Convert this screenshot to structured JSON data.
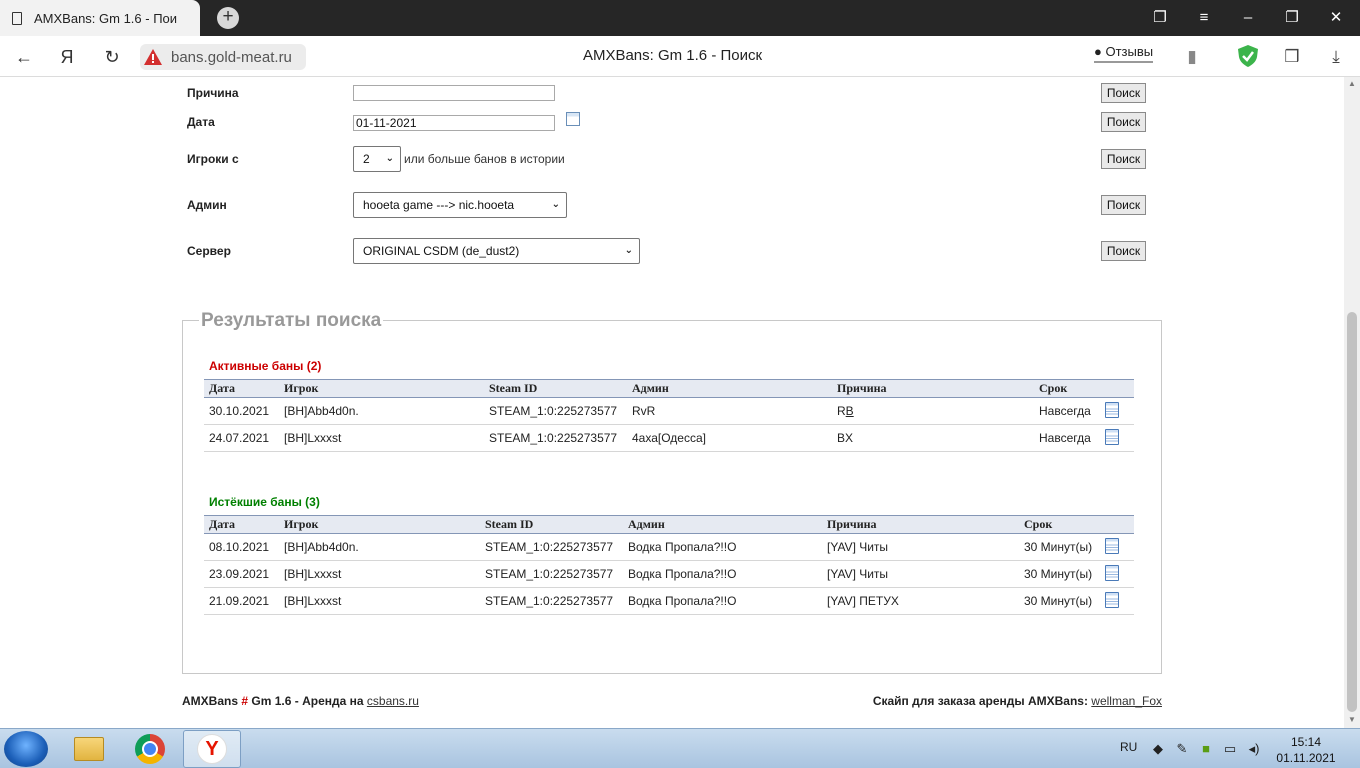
{
  "browser": {
    "tab_title": "AMXBans: Gm 1.6 - Пои",
    "url": "bans.gold-meat.ru",
    "page_title": "AMXBans: Gm 1.6 - Поиск",
    "reviews_label": "Отзывы"
  },
  "form": {
    "reason_label": "Причина",
    "reason_value": "",
    "date_label": "Дата",
    "date_value": "01-11-2021",
    "players_label": "Игроки с",
    "players_count": "2",
    "players_hint": "или больше банов в истории",
    "admin_label": "Админ",
    "admin_selected": "hooeta game ---> nic.hooeta",
    "server_label": "Сервер",
    "server_selected": "ORIGINAL CSDM (de_dust2)",
    "search_button": "Поиск"
  },
  "results": {
    "legend": "Результаты поиска",
    "active": {
      "title": "Активные баны (2)",
      "headers": [
        "Дата",
        "Игрок",
        "Steam ID",
        "Админ",
        "Причина",
        "Срок"
      ],
      "rows": [
        {
          "date": "30.10.2021",
          "player": "[BH]Abb4d0n.",
          "steam": "STEAM_1:0:225273577",
          "admin": "RvR",
          "reason_a": "R",
          "reason_b": "B",
          "term": "Навсегда"
        },
        {
          "date": "24.07.2021",
          "player": "[BH]Lxxxst",
          "steam": "STEAM_1:0:225273577",
          "admin": "4аха[Одесса]",
          "reason_a": "BX",
          "reason_b": "",
          "term": "Навсегда"
        }
      ]
    },
    "expired": {
      "title": "Истёкшие баны (3)",
      "headers": [
        "Дата",
        "Игрок",
        "Steam ID",
        "Админ",
        "Причина",
        "Срок"
      ],
      "rows": [
        {
          "date": "08.10.2021",
          "player": "[BH]Abb4d0n.",
          "steam": "STEAM_1:0:225273577",
          "admin": "Водка Пропала?!!О",
          "reason": "[YAV] Читы",
          "term": "30 Минут(ы)"
        },
        {
          "date": "23.09.2021",
          "player": "[BH]Lxxxst",
          "steam": "STEAM_1:0:225273577",
          "admin": "Водка Пропала?!!О",
          "reason": "[YAV] Читы",
          "term": "30 Минут(ы)"
        },
        {
          "date": "21.09.2021",
          "player": "[BH]Lxxxst",
          "steam": "STEAM_1:0:225273577",
          "admin": "Водка Пропала?!!О",
          "reason": "[YAV] ПЕТУХ",
          "term": "30 Минут(ы)"
        }
      ]
    }
  },
  "footer": {
    "left_prefix": "AMXBans",
    "left_hash": "#",
    "left_mid": "Gm 1.6 - Аренда на",
    "left_link": "csbans.ru",
    "right_text": "Скайп для заказа аренды AMXBans",
    "right_colon": ":",
    "right_link": "wellman_Fox"
  },
  "taskbar": {
    "lang": "RU",
    "time": "15:14",
    "date": "01.11.2021"
  },
  "colors": {
    "active_title": "#cc0000",
    "expired_title": "#008000",
    "table_header_bg": "#e6eaf2"
  }
}
